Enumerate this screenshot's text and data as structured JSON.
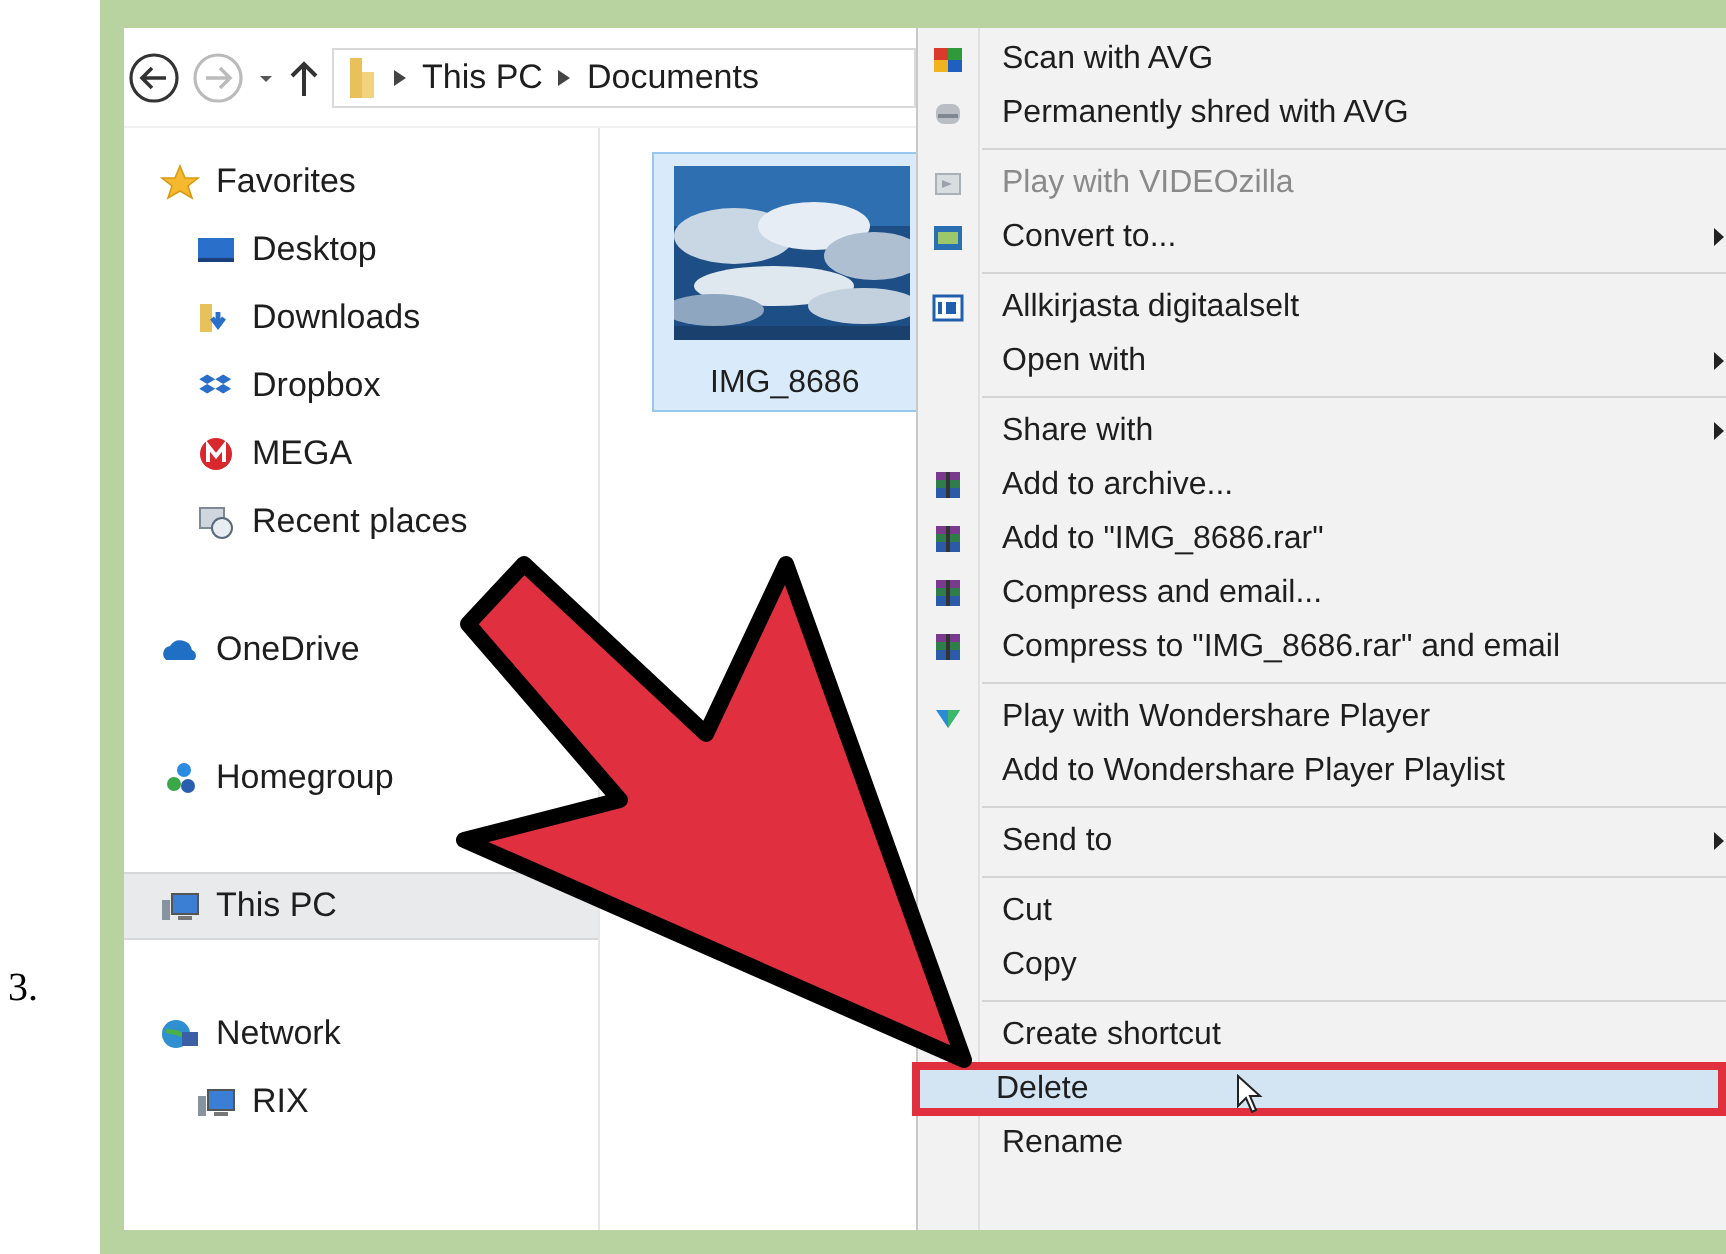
{
  "step": "3.",
  "address": [
    {
      "label": "This PC"
    },
    {
      "label": "Documents"
    }
  ],
  "nav": [
    {
      "label": "Favorites",
      "kind": "star",
      "selected": false,
      "children": [
        {
          "label": "Desktop",
          "kind": "desktop",
          "selected": false
        },
        {
          "label": "Downloads",
          "kind": "downloads",
          "selected": false
        },
        {
          "label": "Dropbox",
          "kind": "dropbox",
          "selected": false
        },
        {
          "label": "MEGA",
          "kind": "mega",
          "selected": false
        },
        {
          "label": "Recent places",
          "kind": "recent",
          "selected": false
        }
      ]
    },
    {
      "label": "OneDrive",
      "kind": "cloud",
      "selected": false
    },
    {
      "label": "Homegroup",
      "kind": "homegroup",
      "selected": false
    },
    {
      "label": "This PC",
      "kind": "pc",
      "selected": true
    },
    {
      "label": "Network",
      "kind": "network",
      "selected": false,
      "children": [
        {
          "label": "RIX",
          "kind": "pc",
          "selected": false
        }
      ]
    }
  ],
  "files": [
    {
      "name": "IMG_8686",
      "kind": "picture",
      "selected": true
    }
  ],
  "menu": [
    {
      "kind": "avg",
      "label": "Scan with AVG",
      "selected": false,
      "disabled": false,
      "submenu": false
    },
    {
      "kind": "shred",
      "label": "Permanently shred with AVG",
      "selected": false,
      "disabled": false,
      "submenu": false
    },
    {
      "kind": "separator"
    },
    {
      "kind": "video",
      "label": "Play with VIDEOzilla",
      "selected": false,
      "disabled": true,
      "submenu": false
    },
    {
      "kind": "convert",
      "label": "Convert to...",
      "selected": false,
      "disabled": false,
      "submenu": true
    },
    {
      "kind": "separator"
    },
    {
      "kind": "sign",
      "label": "Allkirjasta digitaalselt",
      "selected": false,
      "disabled": false,
      "submenu": false
    },
    {
      "kind": "plain",
      "label": "Open with",
      "selected": false,
      "disabled": false,
      "submenu": true
    },
    {
      "kind": "separator"
    },
    {
      "kind": "plain",
      "label": "Share with",
      "selected": false,
      "disabled": false,
      "submenu": true
    },
    {
      "kind": "rar",
      "label": "Add to archive...",
      "selected": false,
      "disabled": false,
      "submenu": false
    },
    {
      "kind": "rar",
      "label": "Add to \"IMG_8686.rar\"",
      "selected": false,
      "disabled": false,
      "submenu": false
    },
    {
      "kind": "rar",
      "label": "Compress and email...",
      "selected": false,
      "disabled": false,
      "submenu": false
    },
    {
      "kind": "rar",
      "label": "Compress to \"IMG_8686.rar\" and email",
      "selected": false,
      "disabled": false,
      "submenu": false
    },
    {
      "kind": "separator"
    },
    {
      "kind": "wondershare",
      "label": "Play with Wondershare Player",
      "selected": false,
      "disabled": false,
      "submenu": false
    },
    {
      "kind": "plain",
      "label": "Add to Wondershare Player Playlist",
      "selected": false,
      "disabled": false,
      "submenu": false
    },
    {
      "kind": "separator"
    },
    {
      "kind": "plain",
      "label": "Send to",
      "selected": false,
      "disabled": false,
      "submenu": true
    },
    {
      "kind": "separator"
    },
    {
      "kind": "plain",
      "label": "Cut",
      "selected": false,
      "disabled": false,
      "submenu": false
    },
    {
      "kind": "plain",
      "label": "Copy",
      "selected": false,
      "disabled": false,
      "submenu": false
    },
    {
      "kind": "separator"
    },
    {
      "kind": "plain",
      "label": "Create shortcut",
      "selected": false,
      "disabled": false,
      "submenu": false
    },
    {
      "kind": "plain",
      "label": "Delete",
      "selected": true,
      "disabled": false,
      "submenu": false
    },
    {
      "kind": "plain",
      "label": "Rename",
      "selected": false,
      "disabled": false,
      "submenu": false
    }
  ]
}
